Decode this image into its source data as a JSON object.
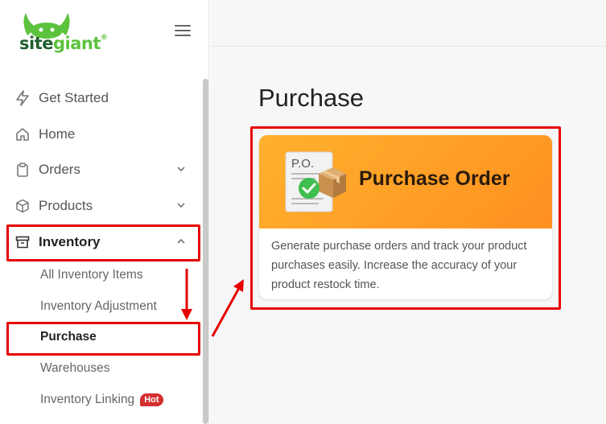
{
  "brand": {
    "part1": "site",
    "part2": "giant",
    "registered": "®"
  },
  "sidebar": {
    "items": [
      {
        "label": "Get Started",
        "icon": "lightning-icon"
      },
      {
        "label": "Home",
        "icon": "home-icon"
      },
      {
        "label": "Orders",
        "icon": "clipboard-icon"
      },
      {
        "label": "Products",
        "icon": "box-icon"
      },
      {
        "label": "Inventory",
        "icon": "archive-icon"
      }
    ],
    "inventory_sub": [
      {
        "label": "All Inventory Items"
      },
      {
        "label": "Inventory Adjustment"
      },
      {
        "label": "Purchase"
      },
      {
        "label": "Warehouses"
      },
      {
        "label": "Inventory Linking",
        "badge": "Hot"
      }
    ]
  },
  "main": {
    "title": "Purchase",
    "card": {
      "title": "Purchase Order",
      "illustration_text": "P.O.",
      "description": "Generate purchase orders and track your product purchases easily. Increase the accuracy of your product restock time."
    }
  },
  "colors": {
    "highlight": "#e60000",
    "brand_dark": "#1f5e2e",
    "brand_green": "#5cc23d",
    "card_orange": "#ff9f26",
    "hot_badge": "#d32f2f"
  }
}
